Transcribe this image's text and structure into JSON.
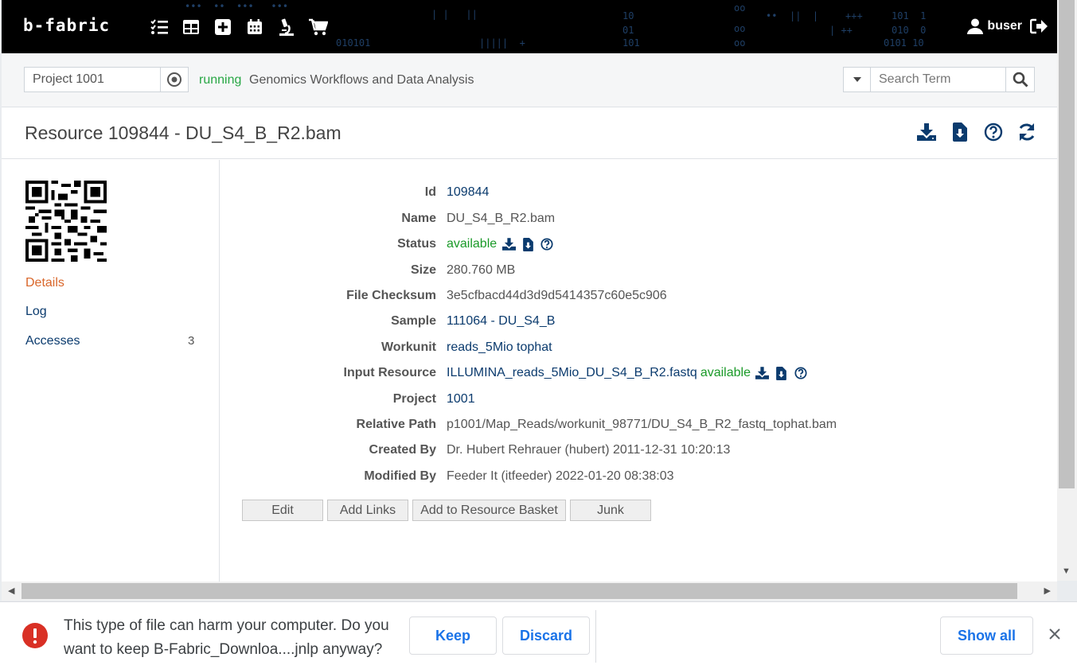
{
  "navbar": {
    "brand": "b-fabric",
    "user": "buser",
    "icons": [
      "checklist-icon",
      "grid-icon",
      "plus-square-icon",
      "calendar-icon",
      "microscope-icon",
      "cart-icon"
    ]
  },
  "project": {
    "selected": "Project 1001",
    "status": "running",
    "name": "Genomics Workflows and Data Analysis"
  },
  "search": {
    "placeholder": "Search Term"
  },
  "resource": {
    "title": "Resource 109844 - DU_S4_B_R2.bam"
  },
  "sidebar": {
    "items": [
      {
        "label": "Details",
        "count": ""
      },
      {
        "label": "Log",
        "count": ""
      },
      {
        "label": "Accesses",
        "count": "3"
      }
    ]
  },
  "fields": {
    "id": {
      "label": "Id",
      "value": "109844"
    },
    "name": {
      "label": "Name",
      "value": "DU_S4_B_R2.bam"
    },
    "status": {
      "label": "Status",
      "value": "available"
    },
    "size": {
      "label": "Size",
      "value": "280.760 MB"
    },
    "checksum": {
      "label": "File Checksum",
      "value": "3e5cfbacd44d3d9d5414357c60e5c906"
    },
    "sample": {
      "label": "Sample",
      "value": "111064 - DU_S4_B"
    },
    "workunit": {
      "label": "Workunit",
      "value": "reads_5Mio tophat"
    },
    "input": {
      "label": "Input Resource",
      "value": "ILLUMINA_reads_5Mio_DU_S4_B_R2.fastq",
      "status": "available"
    },
    "project": {
      "label": "Project",
      "value": "1001"
    },
    "path": {
      "label": "Relative Path",
      "value": "p1001/Map_Reads/workunit_98771/DU_S4_B_R2_fastq_tophat.bam"
    },
    "created": {
      "label": "Created By",
      "value": "Dr. Hubert Rehrauer (hubert) 2011-12-31 10:20:13"
    },
    "modified": {
      "label": "Modified By",
      "value": "Feeder It (itfeeder) 2022-01-20 08:38:03"
    }
  },
  "actions": {
    "edit": "Edit",
    "add_links": "Add Links",
    "add_basket": "Add to Resource Basket",
    "junk": "Junk"
  },
  "download_bar": {
    "message": "This type of file can harm your computer. Do you want to keep B-Fabric_Downloa....jnlp anyway?",
    "keep": "Keep",
    "discard": "Discard",
    "show_all": "Show all"
  },
  "colors": {
    "link": "#0b3b6e",
    "available": "#1a9a28",
    "running": "#28a745",
    "sidebar_active": "#d9662a",
    "warning": "#d93025",
    "chrome_button": "#1a73e8"
  }
}
